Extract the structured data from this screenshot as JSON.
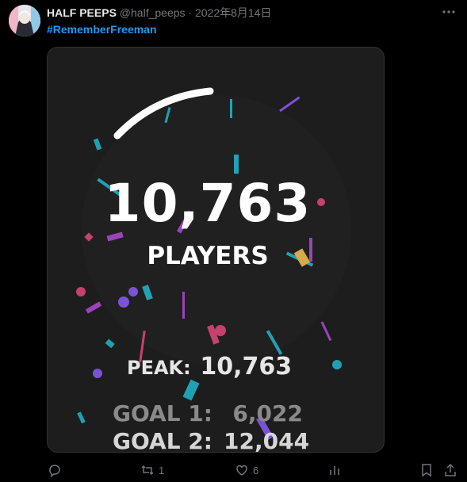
{
  "tweet": {
    "display_name": "HALF PEEPS",
    "handle": "@half_peeps",
    "separator": "·",
    "date": "2022年8月14日",
    "hashtag": "#RememberFreeman",
    "avatar_icon": "avatar-illustration",
    "more_icon": "more-icon"
  },
  "card": {
    "count": "10,763",
    "count_label": "PLAYERS",
    "peak_label": "PEAK:",
    "peak_value": "10,763",
    "goal1_label": "GOAL 1:",
    "goal1_value": "6,022",
    "goal2_label": "GOAL 2:",
    "goal2_value": "12,044",
    "confetti_colors": [
      "#e3477f",
      "#8b5cf6",
      "#22b8cf",
      "#f6c453",
      "#b04ad6"
    ]
  },
  "actions": {
    "reply_icon": "reply-icon",
    "retweet_icon": "retweet-icon",
    "retweet_count": "1",
    "like_icon": "heart-icon",
    "like_count": "6",
    "views_icon": "chart-icon",
    "bookmark_icon": "bookmark-icon",
    "share_icon": "share-icon"
  }
}
